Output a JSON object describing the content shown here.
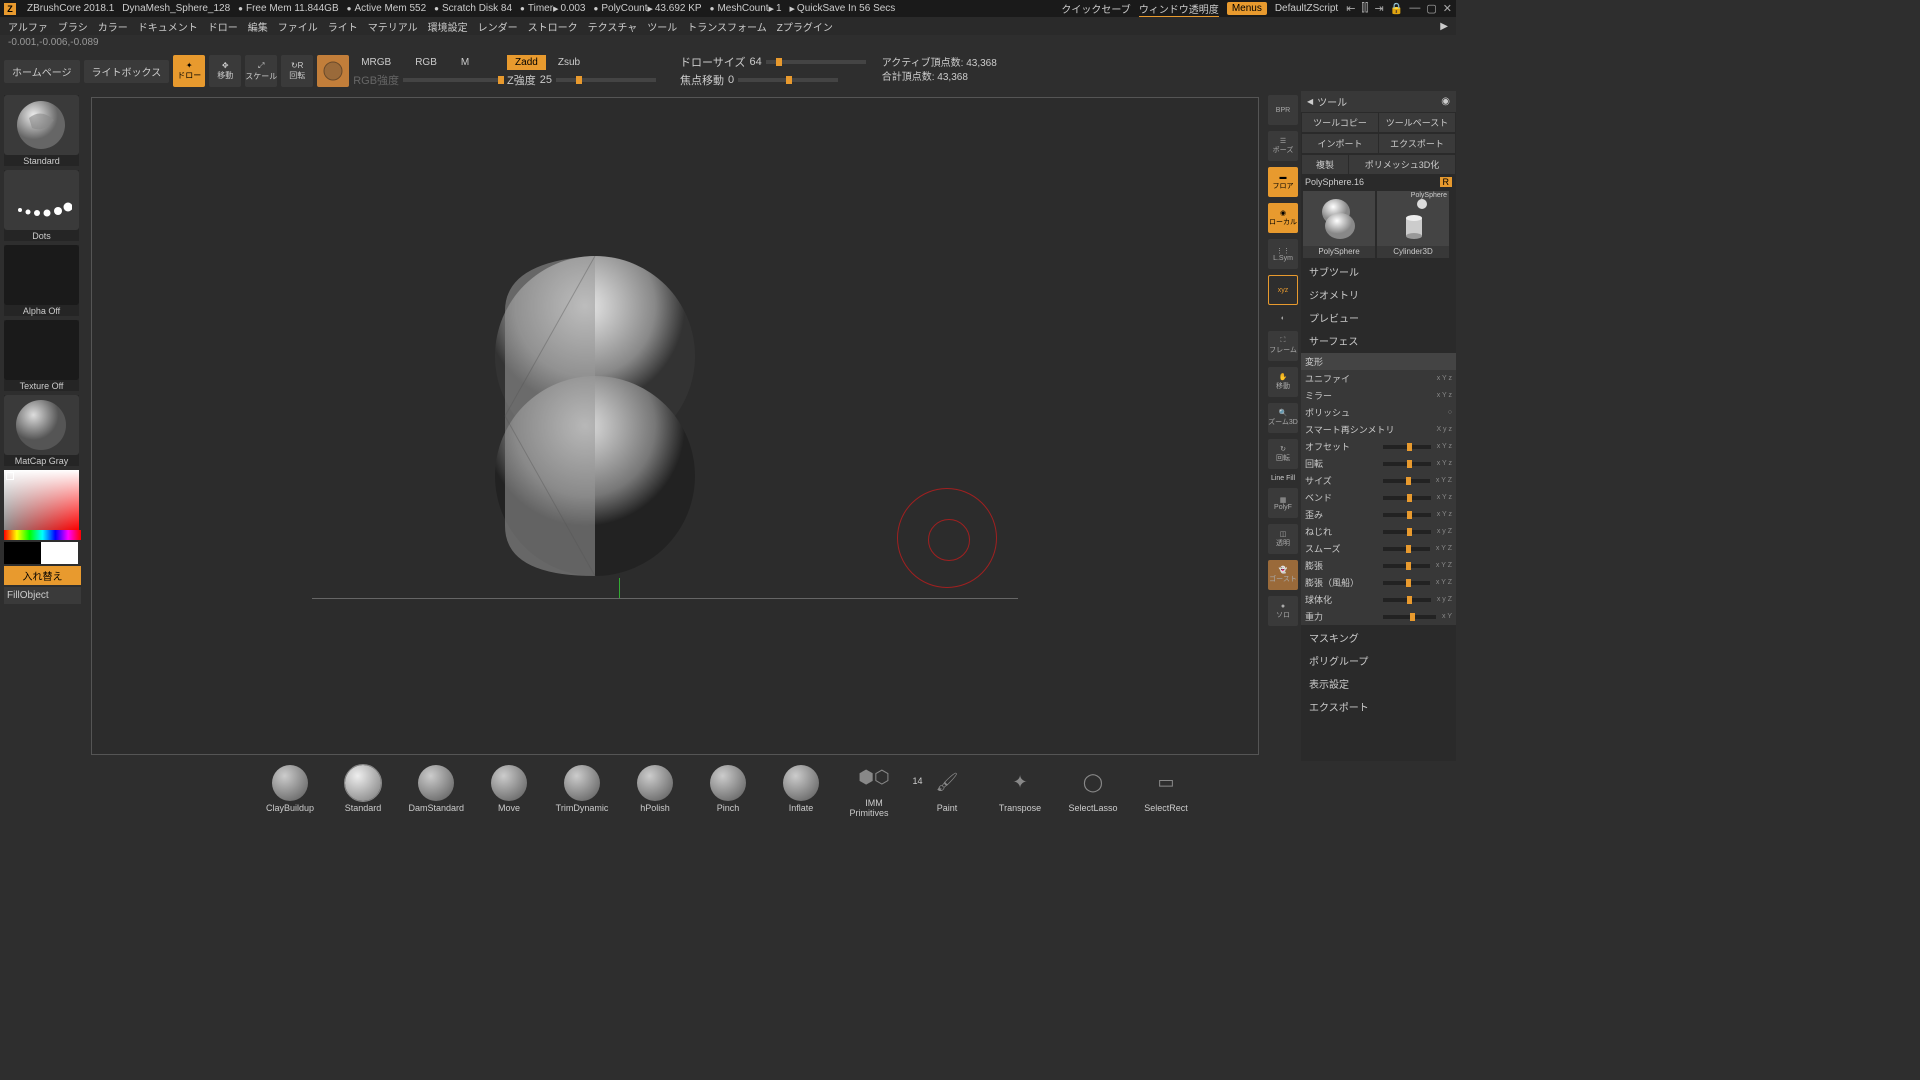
{
  "top": {
    "app": "ZBrushCore 2018.1",
    "doc": "DynaMesh_Sphere_128",
    "free_mem": "Free Mem 11.844GB",
    "active_mem": "Active Mem 552",
    "scratch": "Scratch Disk 84",
    "timer_lbl": "Timer",
    "timer_val": "0.003",
    "poly_lbl": "PolyCount",
    "poly_val": "43.692 KP",
    "mesh_lbl": "MeshCount",
    "mesh_val": "1",
    "quicksave": "QuickSave In 56 Secs",
    "quicksave_jp": "クイックセーブ",
    "win_trans": "ウィンドウ透明度",
    "menus": "Menus",
    "default_script": "DefaultZScript"
  },
  "menubar": [
    "アルファ",
    "ブラシ",
    "カラー",
    "ドキュメント",
    "ドロー",
    "編集",
    "ファイル",
    "ライト",
    "マテリアル",
    "環境設定",
    "レンダー",
    "ストローク",
    "テクスチャ",
    "ツール",
    "トランスフォーム",
    "Zプラグイン"
  ],
  "coord": "-0.001,-0.006,-0.089",
  "toolbar": {
    "home": "ホームページ",
    "lightbox": "ライトボックス",
    "draw": "ドロー",
    "move": "移動",
    "scale": "スケール",
    "rotate": "回転",
    "mrgb": "MRGB",
    "rgb": "RGB",
    "m": "M",
    "rgb_int": "RGB強度",
    "zadd": "Zadd",
    "zsub": "Zsub",
    "zint_label": "Z強度",
    "zint_val": "25",
    "draw_size_lbl": "ドローサイズ",
    "draw_size_val": "64",
    "focal_lbl": "焦点移動",
    "focal_val": "0",
    "active_pts_lbl": "アクティブ頂点数:",
    "active_pts_val": "43,368",
    "total_pts_lbl": "合計頂点数:",
    "total_pts_val": "43,368"
  },
  "left": {
    "brush": "Standard",
    "stroke": "Dots",
    "alpha": "Alpha Off",
    "texture": "Texture Off",
    "material": "MatCap Gray",
    "swap": "入れ替え",
    "fill": "FillObject"
  },
  "shelf": {
    "bpr": "BPR",
    "pose": "ポーズ",
    "floor": "フロア",
    "local": "ローカル",
    "axis": "L.Sym",
    "xyz": "xyz",
    "frame": "フレーム",
    "move": "移動",
    "zoom": "ズーム3D",
    "rotate": "回転",
    "linefill": "Line Fill",
    "polyf": "PolyF",
    "transp": "透明",
    "ghost": "ゴースト",
    "solo": "ソロ"
  },
  "right": {
    "tool": "ツール",
    "copy": "ツールコピー",
    "paste": "ツールペースト",
    "import": "インポート",
    "export": "エクスポート",
    "dup": "複製",
    "poly3d": "ポリメッシュ3D化",
    "polysphere_lbl": "PolySphere.",
    "polysphere_num": "16",
    "r": "R",
    "thumbs": [
      "PolySphere",
      "Cylinder3D"
    ],
    "thumb_small": "PolySphere",
    "sections": [
      "サブツール",
      "ジオメトリ",
      "プレビュー",
      "サーフェス"
    ],
    "deform_hdr": "変形",
    "deform": [
      {
        "name": "ユニファイ",
        "icons": "x Y z"
      },
      {
        "name": "ミラー",
        "icons": "x Y z"
      },
      {
        "name": "ポリッシュ",
        "icons": "○"
      },
      {
        "name": "スマート再シンメトリ",
        "icons": "X y z"
      },
      {
        "name": "オフセット",
        "icons": "x Y z",
        "slider": 50
      },
      {
        "name": "回転",
        "icons": "x Y z",
        "slider": 50
      },
      {
        "name": "サイズ",
        "icons": "x Y Z",
        "slider": 50
      },
      {
        "name": "ベンド",
        "icons": "x Y z",
        "slider": 50
      },
      {
        "name": "歪み",
        "icons": "x Y z",
        "slider": 50
      },
      {
        "name": "ねじれ",
        "icons": "x y Z",
        "slider": 50
      },
      {
        "name": "スムーズ",
        "icons": "x Y Z",
        "slider": 50
      },
      {
        "name": "膨張",
        "icons": "x Y Z",
        "slider": 50
      },
      {
        "name": "膨張（風船）",
        "icons": "x Y Z",
        "slider": 50
      },
      {
        "name": "球体化",
        "icons": "x y Z",
        "slider": 50
      },
      {
        "name": "重力",
        "icons": "x Y",
        "slider": 50
      }
    ],
    "sections2": [
      "マスキング",
      "ポリグループ",
      "表示設定",
      "エクスポート"
    ]
  },
  "brushes": [
    "ClayBuildup",
    "Standard",
    "DamStandard",
    "Move",
    "TrimDynamic",
    "hPolish",
    "Pinch",
    "Inflate",
    "IMM Primitives",
    "Paint",
    "Transpose",
    "SelectLasso",
    "SelectRect"
  ],
  "imm_count": "14"
}
